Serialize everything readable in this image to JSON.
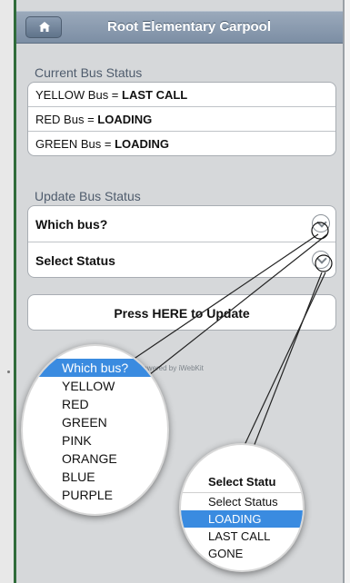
{
  "header": {
    "title": "Root Elementary Carpool",
    "home_icon": "home-icon"
  },
  "current_status": {
    "label": "Current Bus Status",
    "rows": [
      {
        "bus": "YELLOW Bus = ",
        "status": "LAST CALL"
      },
      {
        "bus": "RED Bus = ",
        "status": "LOADING"
      },
      {
        "bus": "GREEN Bus = ",
        "status": "LOADING"
      }
    ]
  },
  "update_status": {
    "label": "Update Bus Status",
    "bus_select": "Which bus?",
    "status_select": "Select Status",
    "button_label": "Press HERE to Update"
  },
  "footer": {
    "powered": "Powered by iWebKit"
  },
  "bus_dropdown": {
    "options": [
      "Which bus?",
      "YELLOW",
      "RED",
      "GREEN",
      "PINK",
      "ORANGE",
      "BLUE",
      "PURPLE"
    ],
    "selected_index": 0
  },
  "status_dropdown": {
    "header": "Select Statu",
    "options": [
      "Select Status",
      "LOADING",
      "LAST CALL",
      "GONE"
    ],
    "selected_index": 1
  },
  "colors": {
    "accent": "#3a8be0",
    "topbar": "#8b9bb0"
  }
}
